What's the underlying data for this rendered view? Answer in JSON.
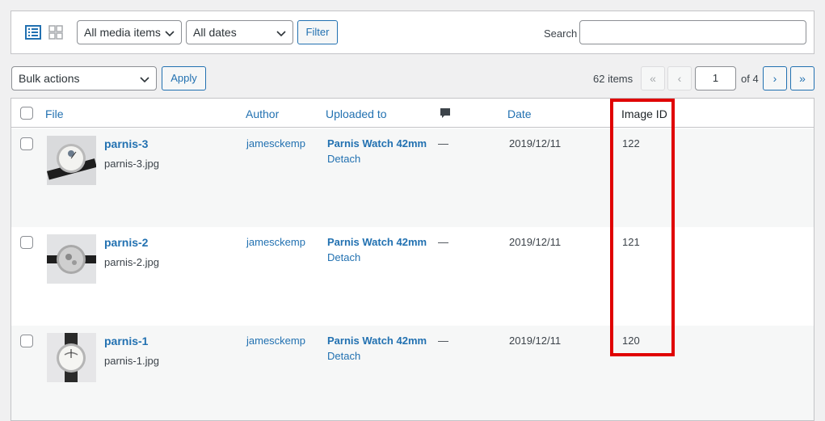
{
  "filters": {
    "media_type": "All media items",
    "dates": "All dates",
    "filter_button": "Filter",
    "search_label": "Search",
    "search_value": ""
  },
  "bulk": {
    "action": "Bulk actions",
    "apply_button": "Apply"
  },
  "pagination": {
    "items_count": "62 items",
    "first": "«",
    "prev": "‹",
    "current_page": "1",
    "of_pages": "of 4",
    "next": "›",
    "last": "»"
  },
  "columns": {
    "file": "File",
    "author": "Author",
    "uploaded_to": "Uploaded to",
    "comments_icon": "comment-bubble-icon",
    "date": "Date",
    "image_id": "Image ID"
  },
  "rows": [
    {
      "title": "parnis-3",
      "filename": "parnis-3.jpg",
      "author": "jamesckemp",
      "uploaded_to": "Parnis Watch 42mm",
      "detach": "Detach",
      "comments": "—",
      "date": "2019/12/11",
      "image_id": "122"
    },
    {
      "title": "parnis-2",
      "filename": "parnis-2.jpg",
      "author": "jamesckemp",
      "uploaded_to": "Parnis Watch 42mm",
      "detach": "Detach",
      "comments": "—",
      "date": "2019/12/11",
      "image_id": "121"
    },
    {
      "title": "parnis-1",
      "filename": "parnis-1.jpg",
      "author": "jamesckemp",
      "uploaded_to": "Parnis Watch 42mm",
      "detach": "Detach",
      "comments": "—",
      "date": "2019/12/11",
      "image_id": "120"
    }
  ],
  "colors": {
    "link": "#2271b1",
    "highlight": "#e00000",
    "row_alt": "#f6f7f7"
  }
}
